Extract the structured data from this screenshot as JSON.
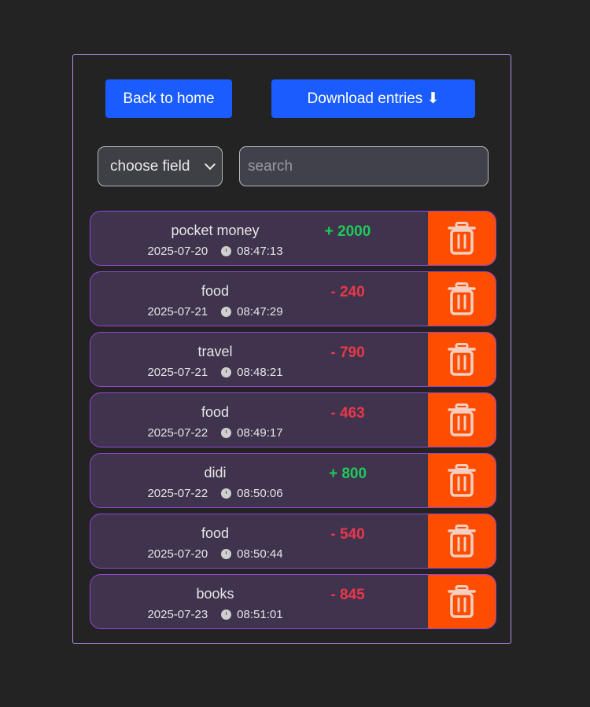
{
  "header": {
    "back_label": "Back to home",
    "download_label": "Download entries ⬇"
  },
  "filter": {
    "select_value": "choose field",
    "search_placeholder": "search"
  },
  "entries": [
    {
      "name": "pocket money",
      "date": "2025-07-20",
      "time": "08:47:13",
      "amount": "+ 2000",
      "type": "pos"
    },
    {
      "name": "food",
      "date": "2025-07-21",
      "time": "08:47:29",
      "amount": "- 240",
      "type": "neg"
    },
    {
      "name": "travel",
      "date": "2025-07-21",
      "time": "08:48:21",
      "amount": "- 790",
      "type": "neg"
    },
    {
      "name": "food",
      "date": "2025-07-22",
      "time": "08:49:17",
      "amount": "- 463",
      "type": "neg"
    },
    {
      "name": "didi",
      "date": "2025-07-22",
      "time": "08:50:06",
      "amount": "+ 800",
      "type": "pos"
    },
    {
      "name": "food",
      "date": "2025-07-20",
      "time": "08:50:44",
      "amount": "- 540",
      "type": "neg"
    },
    {
      "name": "books",
      "date": "2025-07-23",
      "time": "08:51:01",
      "amount": "- 845",
      "type": "neg"
    }
  ],
  "colors": {
    "background": "#232323",
    "primary_button": "#1a5cff",
    "entry_bg": "#40334d",
    "entry_border": "#9446d8",
    "delete_bg": "#ff4d00",
    "positive": "#1ecb5a",
    "negative": "#e8384a"
  },
  "icons": {
    "clock": "clock-icon",
    "delete": "trash-icon"
  }
}
